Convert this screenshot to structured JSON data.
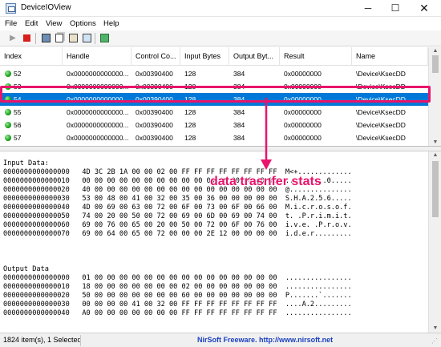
{
  "window": {
    "title": "DeviceIOView",
    "min_glyph": "─",
    "max_glyph": "☐",
    "close_glyph": "✕"
  },
  "menu": [
    "File",
    "Edit",
    "View",
    "Options",
    "Help"
  ],
  "toolbar": {
    "icons": [
      "play-icon",
      "stop-icon",
      "save-icon",
      "copy-icon",
      "properties-icon",
      "html-report-icon",
      "exit-icon"
    ],
    "play_glyph": "▶"
  },
  "list": {
    "columns": [
      "Index",
      "Handle",
      "Control Co...",
      "Input Bytes",
      "Output Byt...",
      "Result",
      "Name"
    ],
    "rows": [
      {
        "index": "52",
        "handle": "0x0000000000000...",
        "control": "0x00390400",
        "input": "128",
        "output": "384",
        "result": "0x00000000",
        "name": "\\Device\\KsecDD",
        "selected": false
      },
      {
        "index": "53",
        "handle": "0x0000000000000...",
        "control": "0x00390400",
        "input": "128",
        "output": "384",
        "result": "0x00000000",
        "name": "\\Device\\KsecDD",
        "selected": false
      },
      {
        "index": "54",
        "handle": "0x0000000000000...",
        "control": "0x00390400",
        "input": "128",
        "output": "384",
        "result": "0x00000000",
        "name": "\\Device\\KsecDD",
        "selected": true
      },
      {
        "index": "55",
        "handle": "0x0000000000000...",
        "control": "0x00390400",
        "input": "128",
        "output": "384",
        "result": "0x00000000",
        "name": "\\Device\\KsecDD",
        "selected": false
      },
      {
        "index": "56",
        "handle": "0x0000000000000...",
        "control": "0x00390400",
        "input": "128",
        "output": "384",
        "result": "0x00000000",
        "name": "\\Device\\KsecDD",
        "selected": false
      },
      {
        "index": "57",
        "handle": "0x0000000000000...",
        "control": "0x00390400",
        "input": "128",
        "output": "384",
        "result": "0x00000000",
        "name": "\\Device\\KsecDD",
        "selected": false
      }
    ]
  },
  "hex": {
    "input_label": "Input Data:",
    "input_lines": [
      {
        "offset": "0000000000000000",
        "bytes": "4D 3C 2B 1A 00 00 02 00 FF FF FF FF FF FF FF FF",
        "ascii": "M<+............."
      },
      {
        "offset": "0000000000000010",
        "bytes": "00 00 00 00 00 00 00 00 00 00 00 00 00 00 00 00",
        "ascii": "..........0....."
      },
      {
        "offset": "0000000000000020",
        "bytes": "40 00 00 00 00 00 00 00 00 00 00 00 00 00 00 00",
        "ascii": "@..............."
      },
      {
        "offset": "0000000000000030",
        "bytes": "53 00 48 00 41 00 32 00 35 00 36 00 00 00 00 00",
        "ascii": "S.H.A.2.5.6....."
      },
      {
        "offset": "0000000000000040",
        "bytes": "4D 00 69 00 63 00 72 00 6F 00 73 00 6F 00 66 00",
        "ascii": "M.i.c.r.o.s.o.f."
      },
      {
        "offset": "0000000000000050",
        "bytes": "74 00 20 00 50 00 72 00 69 00 6D 00 69 00 74 00",
        "ascii": "t. .P.r.i.m.i.t."
      },
      {
        "offset": "0000000000000060",
        "bytes": "69 00 76 00 65 00 20 00 50 00 72 00 6F 00 76 00",
        "ascii": "i.v.e. .P.r.o.v."
      },
      {
        "offset": "0000000000000070",
        "bytes": "69 00 64 00 65 00 72 00 00 00 2E 12 00 00 00 00",
        "ascii": "i.d.e.r........."
      }
    ],
    "output_label": "Output Data",
    "output_lines": [
      {
        "offset": "0000000000000000",
        "bytes": "01 00 00 00 00 00 00 00 00 00 00 00 00 00 00 00",
        "ascii": "................"
      },
      {
        "offset": "0000000000000010",
        "bytes": "18 00 00 00 00 00 00 00 02 00 00 00 00 00 00 00",
        "ascii": "................"
      },
      {
        "offset": "0000000000000020",
        "bytes": "50 00 00 00 00 00 00 00 60 00 00 00 00 00 00 00",
        "ascii": "P.......`......."
      },
      {
        "offset": "0000000000000030",
        "bytes": "00 00 00 00 41 00 32 00 FF FF FF FF FF FF FF FF",
        "ascii": "....A.2........."
      },
      {
        "offset": "0000000000000040",
        "bytes": "A0 00 00 00 00 00 00 00 FF FF FF FF FF FF FF FF",
        "ascii": "................"
      }
    ]
  },
  "annotation": {
    "text": "data trasnfer stats",
    "color": "#e9146b"
  },
  "status": {
    "items": "1824 item(s), 1 Selected",
    "credit": "NirSoft Freeware.  http://www.nirsoft.net"
  },
  "colors": {
    "selection": "#0078d7",
    "highlight": "#e9146b",
    "status_dot": "#17a317",
    "stop": "#d81e1e",
    "link": "#1a3fbf"
  }
}
